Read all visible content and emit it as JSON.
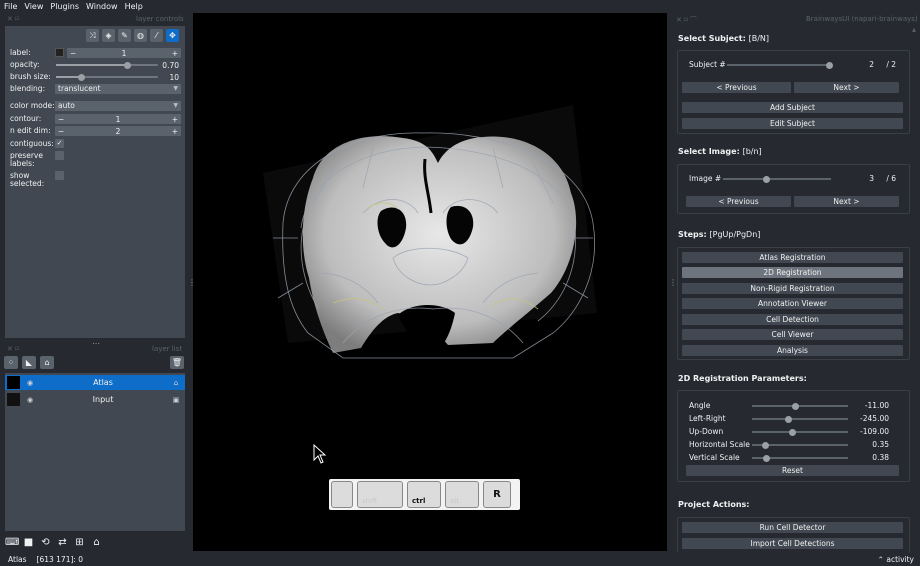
{
  "menu": [
    "File",
    "View",
    "Plugins",
    "Window",
    "Help"
  ],
  "layer_controls": {
    "title": "layer controls",
    "rows": {
      "label": {
        "name": "label:",
        "value": "1"
      },
      "opacity": {
        "name": "opacity:",
        "value": "0.70",
        "fraction": 0.7
      },
      "brush": {
        "name": "brush size:",
        "value": "10",
        "fraction": 0.25
      },
      "blending": {
        "name": "blending:",
        "value": "translucent"
      },
      "color_mode": {
        "name": "color mode:",
        "value": "auto"
      },
      "contour": {
        "name": "contour:",
        "value": "1"
      },
      "n_edit": {
        "name": "n edit dim:",
        "value": "2"
      },
      "contiguous": {
        "name": "contiguous:",
        "checked": true
      },
      "preserve": {
        "name": "preserve labels:",
        "checked": false
      },
      "show_selected": {
        "name": "show selected:",
        "checked": false
      }
    },
    "spin_minus": "−",
    "spin_plus": "+"
  },
  "layer_list": {
    "title": "layer list",
    "layers": [
      {
        "name": "Atlas",
        "selected": true
      },
      {
        "name": "Input",
        "selected": false
      }
    ]
  },
  "status": {
    "layer": "Atlas",
    "coords": "[613 171]: 0",
    "activity": "activity"
  },
  "keys": [
    "",
    "shift",
    "ctrl",
    "alt",
    "R"
  ],
  "plugin": {
    "title": "BrainwaysUI (napari-brainways)",
    "select_subject": {
      "title": "Select Subject:",
      "hint": "[B/N]",
      "label": "Subject #",
      "current": "2",
      "total": "/ 2",
      "fraction": 1.0,
      "prev": "< Previous",
      "next": "Next >",
      "add": "Add Subject",
      "edit": "Edit Subject"
    },
    "select_image": {
      "title": "Select Image:",
      "hint": "[b/n]",
      "label": "Image #",
      "current": "3",
      "total": "/ 6",
      "fraction": 0.4,
      "prev": "< Previous",
      "next": "Next >"
    },
    "steps": {
      "title": "Steps:",
      "hint": "[PgUp/PgDn]",
      "items": [
        "Atlas Registration",
        "2D Registration",
        "Non-Rigid Registration",
        "Annotation Viewer",
        "Cell Detection",
        "Cell Viewer",
        "Analysis"
      ],
      "active_index": 1
    },
    "params": {
      "title": "2D Registration Parameters:",
      "items": [
        {
          "label": "Angle",
          "value": "-11.00",
          "fraction": 0.45
        },
        {
          "label": "Left-Right",
          "value": "-245.00",
          "fraction": 0.38
        },
        {
          "label": "Up-Down",
          "value": "-109.00",
          "fraction": 0.42
        },
        {
          "label": "Horizontal Scale",
          "value": "0.35",
          "fraction": 0.14
        },
        {
          "label": "Vertical Scale",
          "value": "0.38",
          "fraction": 0.15
        }
      ],
      "reset": "Reset"
    },
    "actions": {
      "title": "Project Actions:",
      "items": [
        "Run Cell Detector",
        "Import Cell Detections"
      ]
    }
  }
}
